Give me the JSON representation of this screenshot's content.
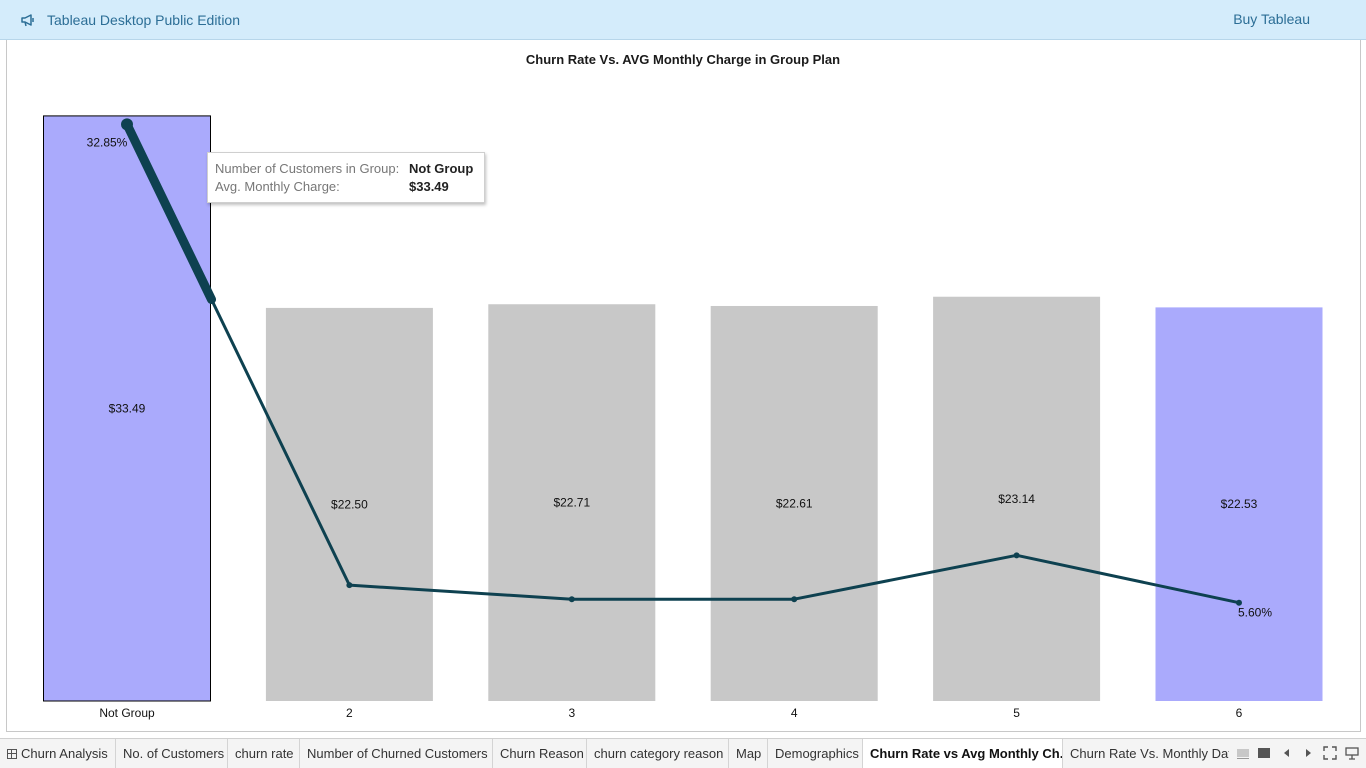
{
  "app": {
    "title": "Tableau Desktop Public Edition",
    "buy_label": "Buy Tableau",
    "megaphone_icon": "megaphone-icon"
  },
  "chart_data": {
    "type": "bar",
    "title": "Churn Rate Vs. AVG Monthly Charge in Group Plan",
    "categories": [
      "Not Group",
      "2",
      "3",
      "4",
      "5",
      "6"
    ],
    "series": [
      {
        "name": "Avg. Monthly Charge",
        "type": "bar",
        "values": [
          33.49,
          22.5,
          22.71,
          22.61,
          23.14,
          22.53
        ],
        "labels": [
          "$33.49",
          "$22.50",
          "$22.71",
          "$22.61",
          "$23.14",
          "$22.53"
        ],
        "colors": [
          "#aaaafc",
          "#c8c8c8",
          "#c8c8c8",
          "#c8c8c8",
          "#c8c8c8",
          "#aaaafc"
        ],
        "ylim": [
          0,
          34
        ]
      },
      {
        "name": "Churn Rate",
        "type": "line",
        "values": [
          32.85,
          6.6,
          5.8,
          5.8,
          8.3,
          5.6
        ],
        "labels": [
          "32.85%",
          "",
          "",
          "",
          "",
          "5.60%"
        ],
        "color": "#0e4150",
        "ylim": [
          0,
          33.5
        ]
      }
    ],
    "highlighted_category": "Not Group",
    "grid": false,
    "legend": "none"
  },
  "tooltip": {
    "row1_label": "Number of Customers in Group:",
    "row1_value": "Not Group",
    "row2_label": "Avg. Monthly Charge:",
    "row2_value": "$33.49"
  },
  "tabs": [
    {
      "label": "Churn Analysis",
      "icon": "grid-icon",
      "active": false
    },
    {
      "label": "No. of Customers",
      "active": false
    },
    {
      "label": "churn rate",
      "active": false
    },
    {
      "label": "Number of Churned Customers",
      "active": false
    },
    {
      "label": "Churn Reason",
      "active": false
    },
    {
      "label": "churn category reason",
      "active": false
    },
    {
      "label": "Map",
      "active": false
    },
    {
      "label": "Demographics",
      "active": false
    },
    {
      "label": "Churn Rate vs Avg Monthly Ch...",
      "active": true
    },
    {
      "label": "Churn Rate Vs. Monthly Dat",
      "active": false
    }
  ],
  "tab_controls": [
    "filmstrip-view-icon",
    "sheet-view-icon",
    "prev-sheet-icon",
    "next-sheet-icon",
    "fullscreen-icon",
    "presentation-icon"
  ]
}
